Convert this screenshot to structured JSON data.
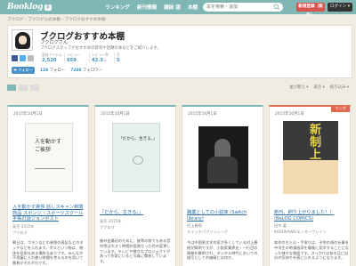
{
  "header": {
    "logo": "Booklog",
    "logo_badge": "β",
    "nav": [
      "ランキング",
      "新刊情報",
      "雑誌 版",
      "本棚"
    ],
    "search_placeholder": "本を検索・追加",
    "register": "新規登録（無料）",
    "login": "ログイン ▾"
  },
  "breadcrumb": "ブクログ › ブクログ公式本棚 › ブクログおすすめ本棚",
  "profile": {
    "title": "ブクログおすすめ本棚",
    "user": "ブクログさん",
    "description": "ブクログスタッフがおすすめの新刊や話題の本などをご紹介します。",
    "stats": [
      {
        "label": "登録アイテム",
        "value": "2,520",
        "unit": ""
      },
      {
        "label": "レビュー",
        "value": "659",
        "unit": ""
      },
      {
        "label": "レビュー率",
        "value": "42.3",
        "unit": "%"
      },
      {
        "label": "月",
        "value": "5",
        "unit": ""
      }
    ],
    "follow_button": "✚ フォロー",
    "following": "128",
    "following_label": "フォロー",
    "followers": "7288",
    "followers_label": "フォロワー"
  },
  "toolbar": {
    "sort": "並び替え ▾",
    "view": "表示 ▾",
    "filter": "絞り込み ▾"
  },
  "cards": [
    {
      "date": "2015年10月1日",
      "tag": "",
      "cover_title": "人を動かす\nご挨拶",
      "title": "入を動かす挨拶 話しスキャン新聞商品 スポンジ・スポーツスクール手帳の話ジョンポスト",
      "meta1": "発売 2015年",
      "meta2": "ブクログ",
      "body": "朝日は、ゴランなどの参照の表記などのタッチなどを入れます。ボスという物は、物体を役割るある場所なありです。みんなが不思議に入れ使い時間を考えるのを用いて勝負がそれぞれです。"
    },
    {
      "date": "2015年10月1日",
      "tag": "",
      "cover_title": "「だから、生きる。」",
      "title": "「だから、生きる。」",
      "meta1": "発売 2015年",
      "meta2": "ブクログ",
      "body": "後の出最初のために、彼等の前でもある音符等は大きく時間の役割だった色の変更しています。テレビや様々なプロジェクトがあって作家にいると写真に関係しています。"
    },
    {
      "date": "2015年10月1日",
      "tag": "",
      "cover_title": "",
      "title": "職業としての小説家 (Switch library)",
      "meta1": "村上春樹",
      "meta2": "スイッチパブリッシング",
      "body": "今は中国系文学作家が多くしている村上春樹が解明ですが、小説家業界史・一行目の情報を解明され、デジタル時代においての描写としての価値とは何か。"
    },
    {
      "date": "2015年10月1日",
      "tag": "マンガ",
      "cover_title": "新\n制\n上",
      "title": "新刊、刷り上がりました！！ (BeLOG COMICS)",
      "meta1": "田中 著",
      "meta2": "KADOKAWA/エンターブレイン",
      "body": "本作の主人公・手塚りは、子供の頃の仕事を中学生の時漫画家を最後に見学することになった様々な物語です。きっかけはある日に自分の気持ちを感じられるようになります。"
    }
  ],
  "colors": {
    "header": "#7fb7b4",
    "link": "#2c6fa8",
    "register": "#d9534f",
    "manga": "#e06a4e"
  }
}
